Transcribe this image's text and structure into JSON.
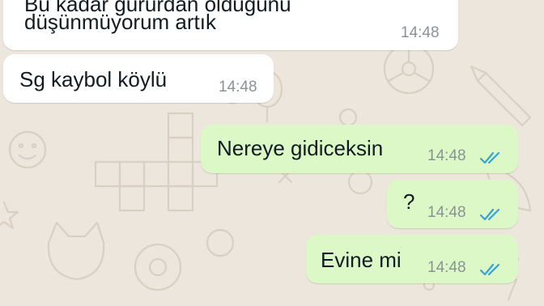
{
  "messages": [
    {
      "direction": "incoming",
      "text_line1": "Bu kadar gururdan olduğunu",
      "text_line2": "düşünmüyorum artık",
      "time": "14:48"
    },
    {
      "direction": "incoming",
      "text": "Sg kaybol köylü",
      "time": "14:48"
    },
    {
      "direction": "outgoing",
      "text": "Nereye gidiceksin",
      "time": "14:48",
      "status": "read"
    },
    {
      "direction": "outgoing",
      "text": "?",
      "time": "14:48",
      "status": "read"
    },
    {
      "direction": "outgoing",
      "text": "Evine mi",
      "time": "14:48",
      "status": "read"
    }
  ],
  "colors": {
    "incoming_bubble": "#ffffff",
    "outgoing_bubble": "#dcf8c6",
    "read_tick": "#34a2e0",
    "background": "#ede6dc"
  }
}
